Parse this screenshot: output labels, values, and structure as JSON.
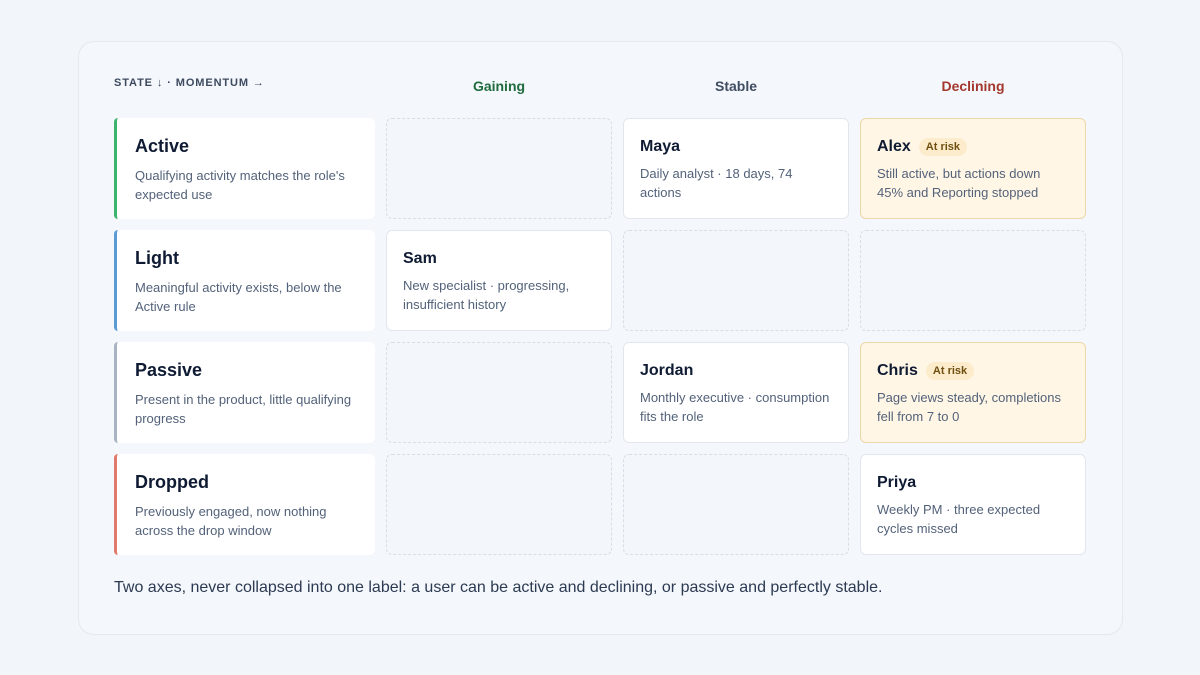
{
  "axis_label": "STATE ↓ · MOMENTUM →",
  "columns": [
    {
      "label": "Gaining",
      "color": "#1f6b3e"
    },
    {
      "label": "Stable",
      "color": "#3f4c61"
    },
    {
      "label": "Declining",
      "color": "#a3382d"
    }
  ],
  "states": [
    {
      "title": "Active",
      "description": "Qualifying activity matches the role's expected use",
      "color": "#3cb46e"
    },
    {
      "title": "Light",
      "description": "Meaningful activity exists, below the Active rule",
      "color": "#5b9bd5"
    },
    {
      "title": "Passive",
      "description": "Present in the product, little qualifying progress",
      "color": "#a9b4c2"
    },
    {
      "title": "Dropped",
      "description": "Previously engaged, now nothing across the drop window",
      "color": "#e07a6a"
    }
  ],
  "users": {
    "maya": {
      "name": "Maya",
      "description": "Daily analyst · 18 days, 74 actions"
    },
    "alex": {
      "name": "Alex",
      "badge": "At risk",
      "description": "Still active, but actions down 45% and Reporting stopped"
    },
    "sam": {
      "name": "Sam",
      "description": "New specialist · progressing, insufficient history"
    },
    "jordan": {
      "name": "Jordan",
      "description": "Monthly executive · consumption fits the role"
    },
    "chris": {
      "name": "Chris",
      "badge": "At risk",
      "description": "Page views steady, completions fell from 7 to 0"
    },
    "priya": {
      "name": "Priya",
      "description": "Weekly PM · three expected cycles missed"
    }
  },
  "footnote": "Two axes, never collapsed into one label: a user can be active and declining, or passive and perfectly stable."
}
